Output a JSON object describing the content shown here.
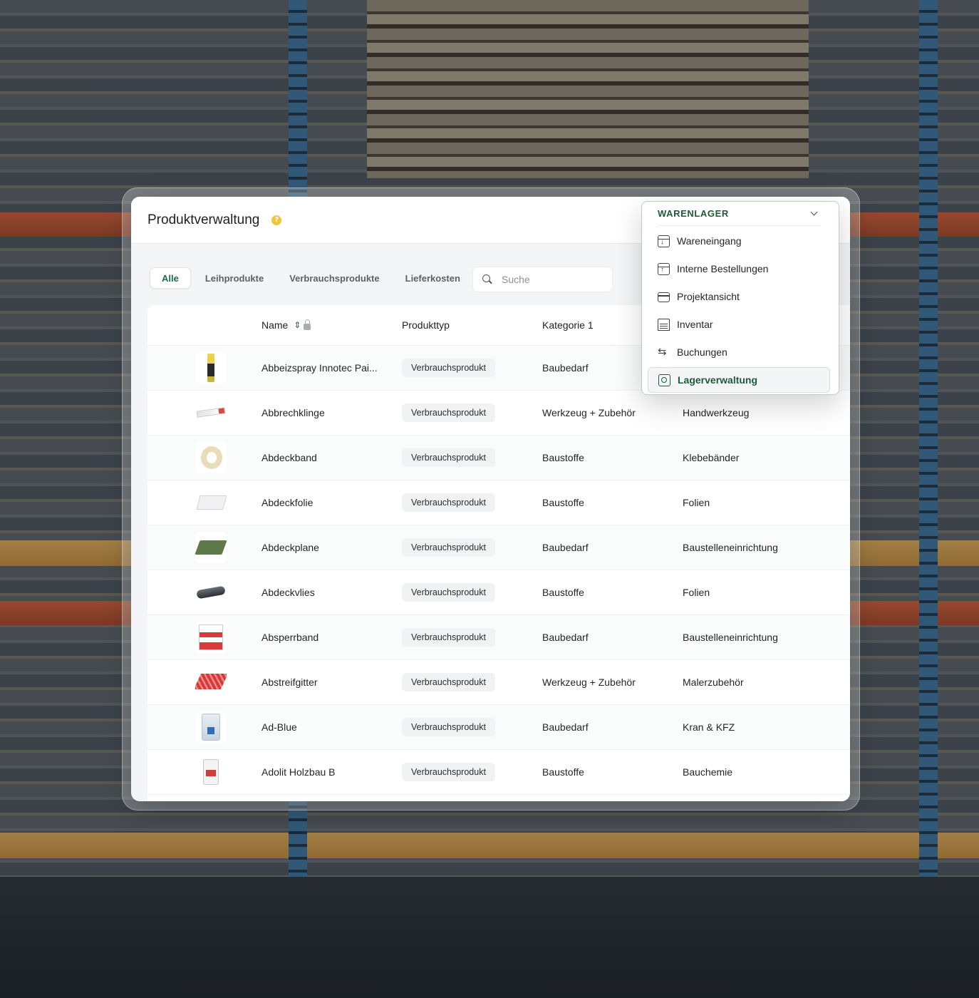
{
  "header": {
    "title": "Produktverwaltung",
    "help_icon": "help-icon",
    "accent": "#f2c53d"
  },
  "tabs": [
    {
      "label": "Alle",
      "active": true
    },
    {
      "label": "Leihprodukte",
      "active": false
    },
    {
      "label": "Verbrauchsprodukte",
      "active": false
    },
    {
      "label": "Lieferkosten",
      "active": false
    }
  ],
  "search": {
    "placeholder": "Suche",
    "value": ""
  },
  "table": {
    "columns": {
      "name": "Name",
      "type": "Produkttyp",
      "cat1": "Kategorie 1",
      "cat2": ""
    },
    "rows": [
      {
        "thumb": "spray-can",
        "name": "Abbeizspray Innotec Pai...",
        "type": "Verbrauchsprodukt",
        "cat1": "Baubedarf",
        "cat2": ""
      },
      {
        "thumb": "blade",
        "name": "Abbrechklinge",
        "type": "Verbrauchsprodukt",
        "cat1": "Werkzeug + Zubehör",
        "cat2": "Handwerkzeug"
      },
      {
        "thumb": "tape",
        "name": "Abdeckband",
        "type": "Verbrauchsprodukt",
        "cat1": "Baustoffe",
        "cat2": "Klebebänder"
      },
      {
        "thumb": "foil",
        "name": "Abdeckfolie",
        "type": "Verbrauchsprodukt",
        "cat1": "Baustoffe",
        "cat2": "Folien"
      },
      {
        "thumb": "tarp",
        "name": "Abdeckplane",
        "type": "Verbrauchsprodukt",
        "cat1": "Baubedarf",
        "cat2": "Baustelleneinrichtung"
      },
      {
        "thumb": "fleece-roll",
        "name": "Abdeckvlies",
        "type": "Verbrauchsprodukt",
        "cat1": "Baustoffe",
        "cat2": "Folien"
      },
      {
        "thumb": "barrier-tape",
        "name": "Absperrband",
        "type": "Verbrauchsprodukt",
        "cat1": "Baubedarf",
        "cat2": "Baustelleneinrichtung"
      },
      {
        "thumb": "grid",
        "name": "Abstreifgitter",
        "type": "Verbrauchsprodukt",
        "cat1": "Werkzeug + Zubehör",
        "cat2": "Malerzubehör"
      },
      {
        "thumb": "canister",
        "name": "Ad-Blue",
        "type": "Verbrauchsprodukt",
        "cat1": "Baubedarf",
        "cat2": "Kran & KFZ"
      },
      {
        "thumb": "bottle",
        "name": "Adolit Holzbau B",
        "type": "Verbrauchsprodukt",
        "cat1": "Baustoffe",
        "cat2": "Bauchemie"
      }
    ]
  },
  "dropdown": {
    "title": "WARENLAGER",
    "items": [
      {
        "label": "Wareneingang",
        "icon": "inbox-download-icon",
        "active": false
      },
      {
        "label": "Interne Bestellungen",
        "icon": "inbox-upload-icon",
        "active": false
      },
      {
        "label": "Projektansicht",
        "icon": "calendar-icon",
        "active": false
      },
      {
        "label": "Inventar",
        "icon": "inventory-icon",
        "active": false
      },
      {
        "label": "Buchungen",
        "icon": "swap-arrows-icon",
        "active": false
      },
      {
        "label": "Lagerverwaltung",
        "icon": "warehouse-icon",
        "active": true
      }
    ],
    "accent": "#1f5a3a"
  }
}
